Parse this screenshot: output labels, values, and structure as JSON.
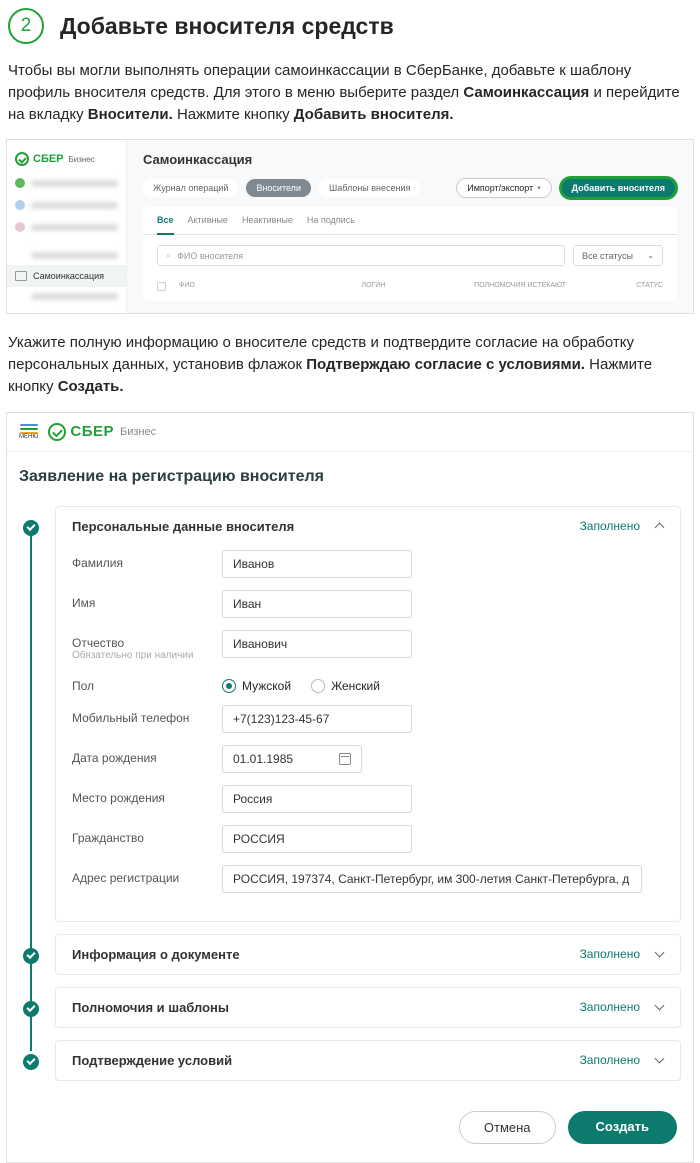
{
  "step": {
    "number": "2",
    "title": "Добавьте вносителя средств"
  },
  "instruction1_parts": {
    "p1": "Чтобы вы могли выполнять операции самоинкассации в СберБанке, добавьте к шаблону профиль вносителя средств. Для этого в меню выберите раздел ",
    "b1": "Самоинкассация",
    "p2": " и перейдите на вкладку ",
    "b2": "Вносители.",
    "p3": " Нажмите кнопку ",
    "b3": "Добавить вносителя."
  },
  "shot1": {
    "logo": "СБЕР",
    "logo_sub": "Бизнес",
    "side_active": "Самоинкассация",
    "title": "Самоинкассация",
    "tabs": [
      "Журнал операций",
      "Вносители",
      "Шаблоны внесения"
    ],
    "import_export": "Импорт/экспорт",
    "add_btn": "Добавить вносителя",
    "subtabs": [
      "Все",
      "Активные",
      "Неактивные",
      "На подпись"
    ],
    "search_ph": "ФИО вносителя",
    "status_sel": "Все статусы",
    "thead": {
      "cb": "",
      "fio": "ФИО",
      "login": "ЛОГИН",
      "expire": "ПОЛНОМОЧИЯ ИСТЕКАЮТ",
      "status": "СТАТУС"
    }
  },
  "instruction2_parts": {
    "p1": "Укажите полную информацию о вносителе средств и подтвердите согласие на обработку персональных данных, установив флажок ",
    "b1": "Подтверждаю согласие с условиями.",
    "p2": " Нажмите кнопку ",
    "b2": "Создать."
  },
  "shot2": {
    "menu_label": "МЕНЮ",
    "logo": "СБЕР",
    "logo_sub": "Бизнес",
    "form_title": "Заявление на регистрацию вносителя",
    "sections": {
      "s1": {
        "title": "Персональные данные вносителя",
        "status": "Заполнено"
      },
      "s2": {
        "title": "Информация о документе",
        "status": "Заполнено"
      },
      "s3": {
        "title": "Полномочия и шаблоны",
        "status": "Заполнено"
      },
      "s4": {
        "title": "Подтверждение условий",
        "status": "Заполнено"
      }
    },
    "fields": {
      "lastname": {
        "label": "Фамилия",
        "value": "Иванов"
      },
      "firstname": {
        "label": "Имя",
        "value": "Иван"
      },
      "middlename": {
        "label": "Отчество",
        "sub": "Обязательно при наличии",
        "value": "Иванович"
      },
      "gender": {
        "label": "Пол",
        "male": "Мужской",
        "female": "Женский"
      },
      "phone": {
        "label": "Мобильный телефон",
        "value": "+7(123)123-45-67"
      },
      "dob": {
        "label": "Дата рождения",
        "value": "01.01.1985"
      },
      "pob": {
        "label": "Место рождения",
        "value": "Россия"
      },
      "citizenship": {
        "label": "Гражданство",
        "value": "РОССИЯ"
      },
      "address": {
        "label": "Адрес регистрации",
        "value": "РОССИЯ, 197374, Санкт-Петербург, им 300-летия Санкт-Петербурга, д"
      }
    },
    "cancel_btn": "Отмена",
    "create_btn": "Создать"
  }
}
